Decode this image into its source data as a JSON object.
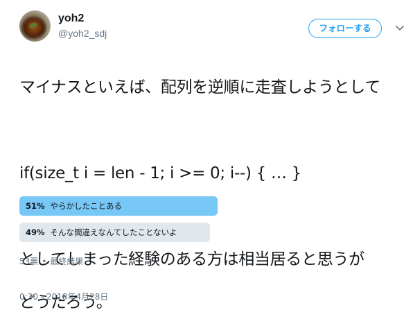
{
  "user": {
    "name": "yoh2",
    "handle": "@yoh2_sdj"
  },
  "follow_button": {
    "label": "フォローする"
  },
  "menu": {
    "icon": "chevron-down-icon"
  },
  "tweet": {
    "lines": [
      "マイナスといえば、配列を逆順に走査しようとして",
      "",
      "if(size_t i = len - 1; i >= 0; i--) { … }",
      "",
      "としてしまった経験のある方は相当居ると思うが",
      "どうだろう。"
    ]
  },
  "poll": {
    "options": [
      {
        "percent_label": "51%",
        "percent": 51,
        "label": "やらかしたことある",
        "winner": true
      },
      {
        "percent_label": "49%",
        "percent": 49,
        "label": "そんな間違えなんてしたことないよ",
        "winner": false
      }
    ],
    "votes": "53票",
    "separator": "•",
    "status": "最終結果"
  },
  "timestamp": "0:30 - 2018年4月28日",
  "colors": {
    "accent": "#1da1f2",
    "winner_bar": "#77c7f7",
    "other_bar": "#e1e8ed",
    "muted_text": "#657786"
  }
}
